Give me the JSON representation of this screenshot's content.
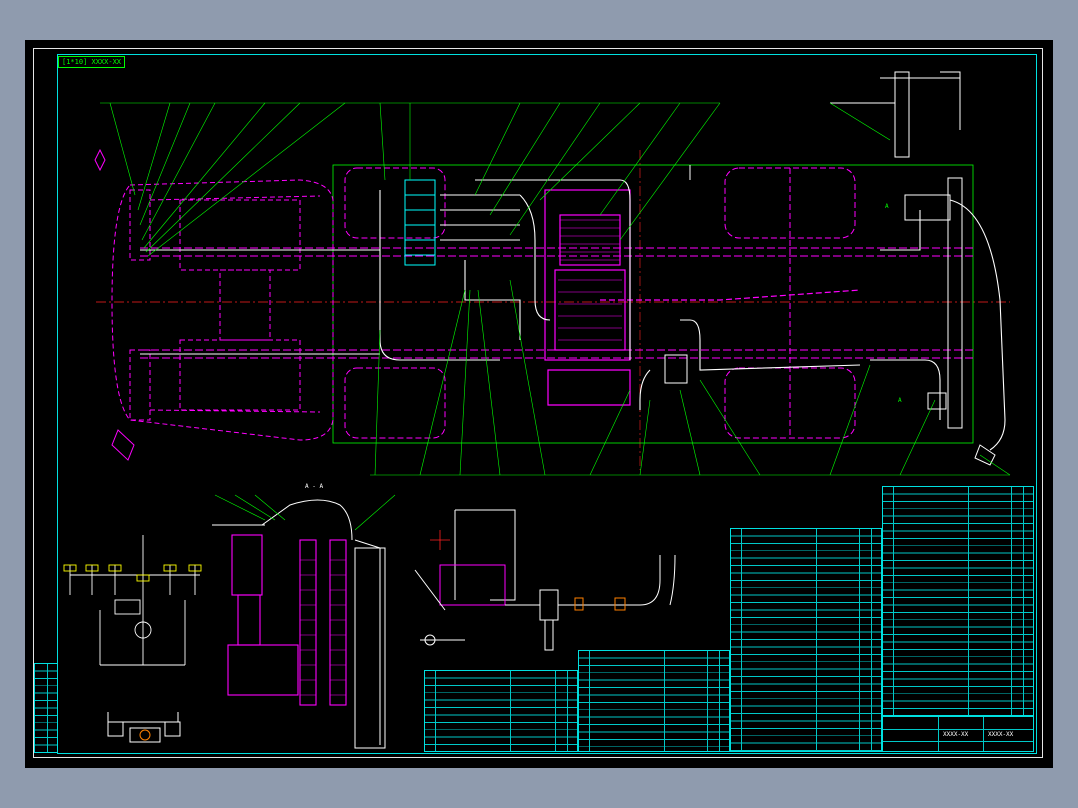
{
  "drawing": {
    "title_tag": "[1*10] XXXX-XX",
    "section_label": "A - A",
    "detail_label": "A",
    "drawing_name": "XXXX-XX",
    "drawing_number": "XXXX-XX"
  },
  "colors": {
    "background": "#8f9bae",
    "sheet": "#000000",
    "frame": "#00e0e0",
    "chassis": "#ff00ff",
    "piping": "#ffffff",
    "leaders": "#00ff00",
    "centerline": "#ff2020",
    "cyan": "#00ffff",
    "yellow": "#ffff00",
    "orange": "#ff8000"
  }
}
